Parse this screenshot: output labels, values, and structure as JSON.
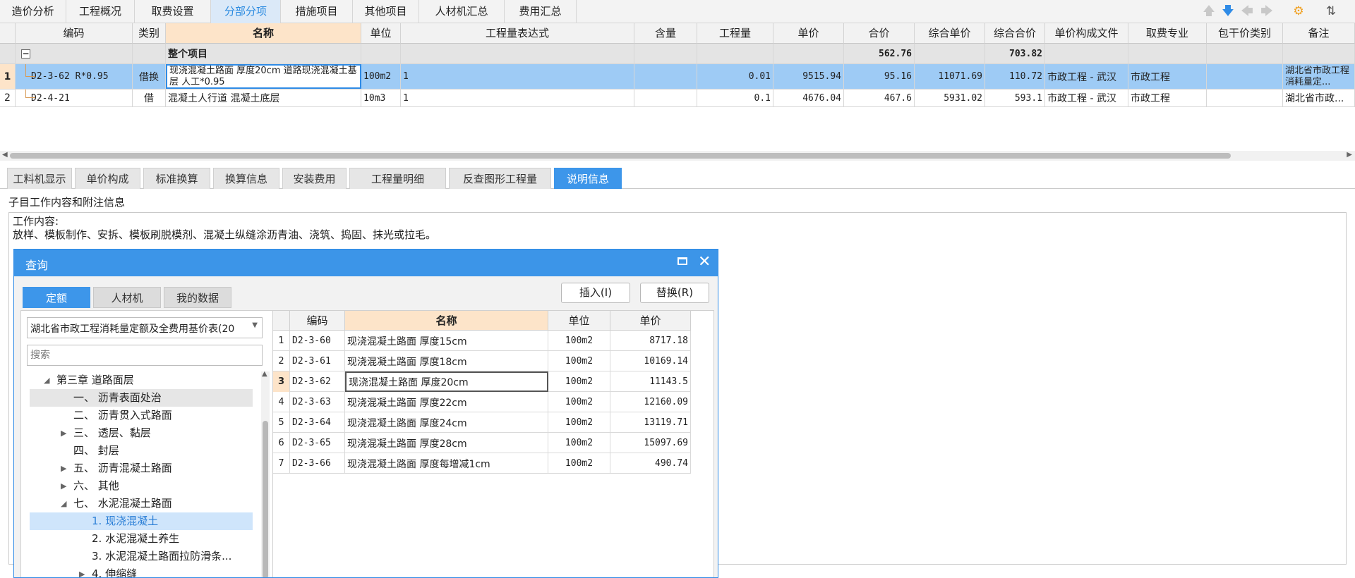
{
  "top_tabs": [
    "造价分析",
    "工程概况",
    "取费设置",
    "分部分项",
    "措施项目",
    "其他项目",
    "人材机汇总",
    "费用汇总"
  ],
  "top_tab_active": 3,
  "toolbar_icons": [
    "arrow-up-icon",
    "arrow-down-icon",
    "arrow-left-icon",
    "arrow-right-icon",
    "settings-icon",
    "sort-icon"
  ],
  "grid": {
    "headers": [
      "",
      "编码",
      "类别",
      "名称",
      "单位",
      "工程量表达式",
      "含量",
      "工程量",
      "单价",
      "合价",
      "综合单价",
      "综合合价",
      "单价构成文件",
      "取费专业",
      "包干价类别",
      "备注"
    ],
    "group_row": {
      "toggle": "−",
      "name": "整个项目",
      "total": "562.76",
      "comp_total": "703.82"
    },
    "rows": [
      {
        "idx": "1",
        "code": "D2-3-62 R*0.95",
        "type": "借换",
        "name": "现浇混凝土路面 厚度20cm  道路现浇混凝土基层 人工*0.95",
        "unit": "100m2",
        "expr": "1",
        "content": "",
        "qty": "0.01",
        "price": "9515.94",
        "total": "95.16",
        "comp_price": "11071.69",
        "comp_total": "110.72",
        "file": "市政工程 - 武汉",
        "specialty": "市政工程",
        "pkg": "",
        "note": "湖北省市政工程消耗量定..."
      },
      {
        "idx": "2",
        "code": "D2-4-21",
        "type": "借",
        "name": "混凝土人行道 混凝土底层",
        "unit": "10m3",
        "expr": "1",
        "content": "",
        "qty": "0.1",
        "price": "4676.04",
        "total": "467.6",
        "comp_price": "5931.02",
        "comp_total": "593.1",
        "file": "市政工程 - 武汉",
        "specialty": "市政工程",
        "pkg": "",
        "note": "湖北省市政..."
      }
    ]
  },
  "bottom_tabs": [
    "工料机显示",
    "单价构成",
    "标准换算",
    "换算信息",
    "安装费用",
    "工程量明细",
    "反查图形工程量",
    "说明信息"
  ],
  "bottom_tab_active": 7,
  "info": {
    "label": "子目工作内容和附注信息",
    "line1": "工作内容:",
    "line2": "放样、模板制作、安拆、模板刷脱模剂、混凝土纵缝涂沥青油、浇筑、捣固、抹光或拉毛。"
  },
  "dialog": {
    "title": "查询",
    "tabs": [
      "定额",
      "人材机",
      "我的数据"
    ],
    "tab_active": 0,
    "insert_label": "插入(I)",
    "replace_label": "替换(R)",
    "library_select": "湖北省市政工程消耗量定额及全费用基价表(20",
    "search_placeholder": "搜索",
    "tree": [
      {
        "label": "第三章 道路面层",
        "level": 0,
        "arrow": "down",
        "state": ""
      },
      {
        "label": "一、 沥青表面处治",
        "level": 1,
        "arrow": "",
        "state": "hover"
      },
      {
        "label": "二、 沥青贯入式路面",
        "level": 1,
        "arrow": "",
        "state": ""
      },
      {
        "label": "三、 透层、黏层",
        "level": 1,
        "arrow": "right",
        "state": ""
      },
      {
        "label": "四、 封层",
        "level": 1,
        "arrow": "",
        "state": ""
      },
      {
        "label": "五、 沥青混凝土路面",
        "level": 1,
        "arrow": "right",
        "state": ""
      },
      {
        "label": "六、 其他",
        "level": 1,
        "arrow": "right",
        "state": ""
      },
      {
        "label": "七、 水泥混凝土路面",
        "level": 1,
        "arrow": "down",
        "state": ""
      },
      {
        "label": "1. 现浇混凝土",
        "level": 2,
        "arrow": "",
        "state": "selected"
      },
      {
        "label": "2. 水泥混凝土养生",
        "level": 2,
        "arrow": "",
        "state": ""
      },
      {
        "label": "3. 水泥混凝土路面拉防滑条...",
        "level": 2,
        "arrow": "",
        "state": ""
      },
      {
        "label": "4. 伸缩缝",
        "level": 2,
        "arrow": "right",
        "state": ""
      }
    ],
    "table_headers": [
      "",
      "编码",
      "名称",
      "单位",
      "单价"
    ],
    "table_rows": [
      {
        "idx": "1",
        "code": "D2-3-60",
        "name": "现浇混凝土路面 厚度15cm",
        "unit": "100m2",
        "price": "8717.18"
      },
      {
        "idx": "2",
        "code": "D2-3-61",
        "name": "现浇混凝土路面 厚度18cm",
        "unit": "100m2",
        "price": "10169.14"
      },
      {
        "idx": "3",
        "code": "D2-3-62",
        "name": "现浇混凝土路面 厚度20cm",
        "unit": "100m2",
        "price": "11143.5"
      },
      {
        "idx": "4",
        "code": "D2-3-63",
        "name": "现浇混凝土路面 厚度22cm",
        "unit": "100m2",
        "price": "12160.09"
      },
      {
        "idx": "5",
        "code": "D2-3-64",
        "name": "现浇混凝土路面 厚度24cm",
        "unit": "100m2",
        "price": "13119.71"
      },
      {
        "idx": "6",
        "code": "D2-3-65",
        "name": "现浇混凝土路面 厚度28cm",
        "unit": "100m2",
        "price": "15097.69"
      },
      {
        "idx": "7",
        "code": "D2-3-66",
        "name": "现浇混凝土路面 厚度每增减1cm",
        "unit": "100m2",
        "price": "490.74"
      }
    ],
    "table_selected": 2
  }
}
